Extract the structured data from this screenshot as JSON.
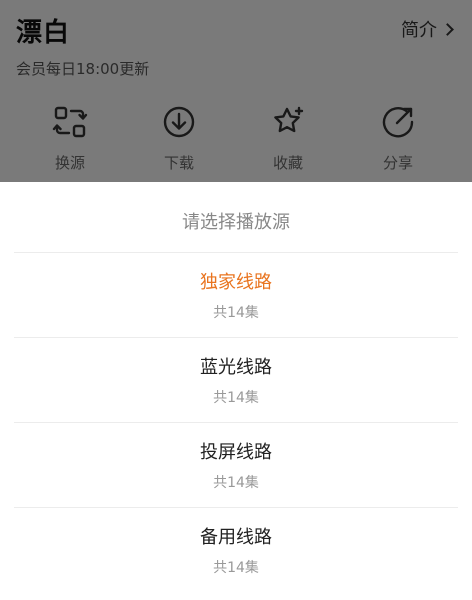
{
  "header": {
    "title": "漂白",
    "intro_label": "简介",
    "subtitle": "会员每日18:00更新"
  },
  "actions": [
    {
      "label": "换源",
      "icon": "switch-source-icon"
    },
    {
      "label": "下载",
      "icon": "download-icon"
    },
    {
      "label": "收藏",
      "icon": "star-icon"
    },
    {
      "label": "分享",
      "icon": "share-icon"
    }
  ],
  "sheet": {
    "title": "请选择播放源",
    "options": [
      {
        "name": "独家线路",
        "count": "共14集",
        "selected": true
      },
      {
        "name": "蓝光线路",
        "count": "共14集",
        "selected": false
      },
      {
        "name": "投屏线路",
        "count": "共14集",
        "selected": false
      },
      {
        "name": "备用线路",
        "count": "共14集",
        "selected": false
      }
    ]
  },
  "colors": {
    "accent": "#e9741f",
    "overlay": "rgba(0,0,0,0.5)"
  }
}
